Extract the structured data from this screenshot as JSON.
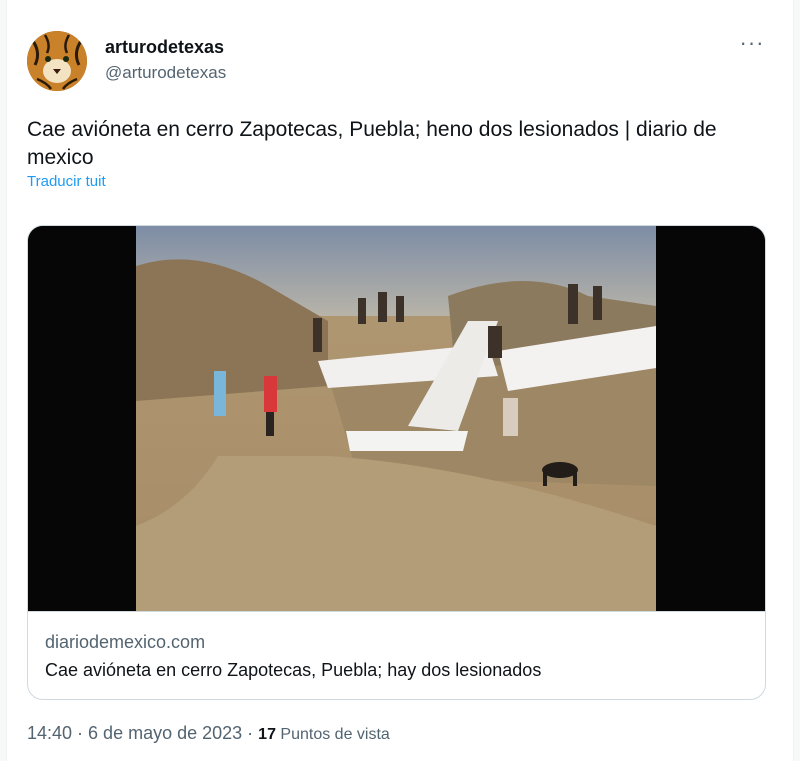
{
  "author": {
    "display_name": "arturodetexas",
    "handle": "@arturodetexas",
    "avatar_icon": "tiger-avatar"
  },
  "more_menu": {
    "label": "···",
    "icon": "more-horizontal-icon"
  },
  "tweet": {
    "text": "Cae avióneta en cerro Zapotecas, Puebla; heno dos lesionados | diario de mexico",
    "translate_label": "Traducir tuit"
  },
  "link_card": {
    "domain": "diariodemexico.com",
    "title": "Cae avióneta en cerro Zapotecas, Puebla; hay dos lesionados"
  },
  "footer": {
    "time": "14:40",
    "separator1": " · ",
    "date": "6 de mayo de 2023",
    "separator2": " · ",
    "views_count": "17",
    "views_label": " Puntos de vista"
  },
  "colors": {
    "link": "#1d9bf0",
    "secondary_text": "#536471",
    "primary_text": "#0f1419",
    "border": "#cfd9de"
  }
}
